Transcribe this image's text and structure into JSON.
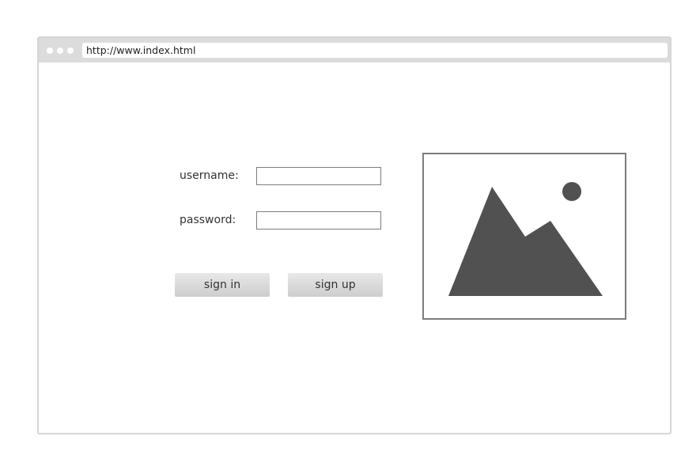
{
  "browser": {
    "url": "http://www.index.html"
  },
  "form": {
    "username_label": "username:",
    "username_value": "",
    "password_label": "password:",
    "password_value": "",
    "sign_in_label": "sign in",
    "sign_up_label": "sign up"
  },
  "image": {
    "icon": "image-placeholder-icon",
    "fill_color": "#515151"
  }
}
